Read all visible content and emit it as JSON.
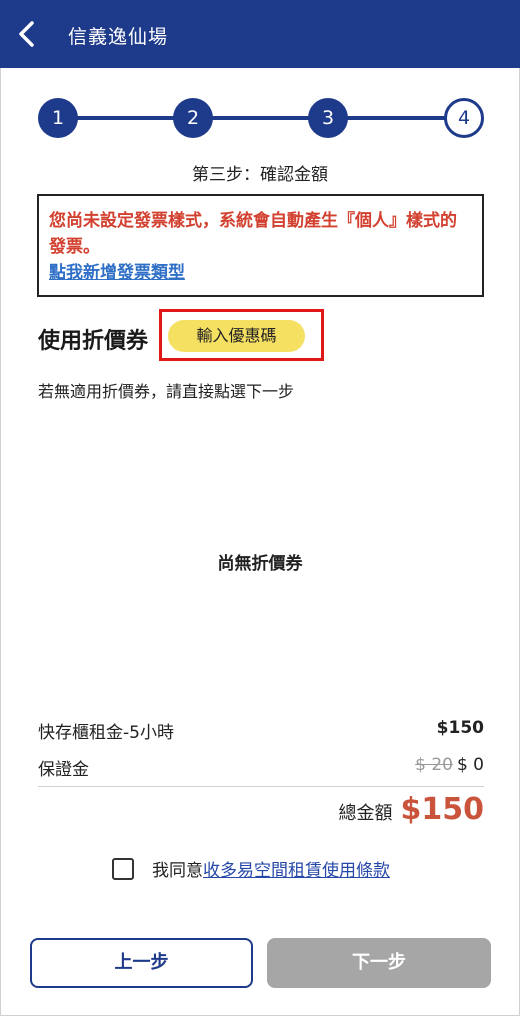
{
  "header": {
    "title": "信義逸仙場",
    "back_icon": "chevron-left-icon"
  },
  "stepper": {
    "steps": [
      "1",
      "2",
      "3",
      "4"
    ],
    "current": 4,
    "caption": "第三步：確認金額"
  },
  "notice": {
    "message": "您尚未設定發票樣式，系統會自動產生『個人』樣式的發票。",
    "link": "點我新增發票類型"
  },
  "coupon": {
    "title": "使用折價券",
    "enter_code_label": "輸入優惠碼",
    "hint": "若無適用折價券，請直接點選下一步",
    "empty_text": "尚無折價券"
  },
  "fees": {
    "rows": [
      {
        "label": "快存櫃租金-5小時",
        "amount": "$150"
      },
      {
        "label": "保證金",
        "original": "$ 20",
        "amount": "$ 0"
      }
    ],
    "total_label": "總金額",
    "total_value": "$150"
  },
  "agreement": {
    "prefix": "我同意",
    "link": "收多易空間租賃使用條款"
  },
  "buttons": {
    "prev": "上一步",
    "next": "下一步"
  },
  "colors": {
    "primary": "#1e3a8a",
    "notice_red": "#d2402f",
    "total_red": "#c9533b",
    "coupon_yellow": "#f5e062",
    "disabled_gray": "#a6a6a6",
    "highlight_red": "#e01818"
  }
}
